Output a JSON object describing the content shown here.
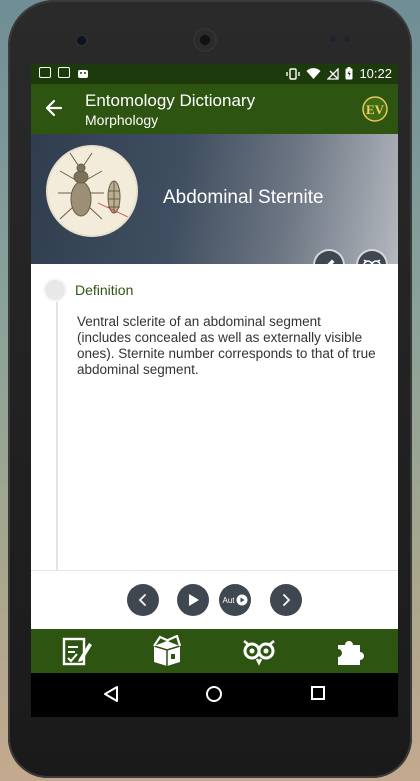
{
  "status_bar": {
    "time": "10:22",
    "left_icons": [
      "image-icon",
      "clipboard-check-icon",
      "android-icon"
    ],
    "right_icons": [
      "vibrate-icon",
      "wifi-icon",
      "signal-icon",
      "battery-icon"
    ]
  },
  "app_bar": {
    "title": "Entomology Dictionary",
    "subtitle": "Morphology",
    "back_icon": "arrow-left-icon",
    "logo_text": "EV"
  },
  "entry": {
    "term": "Abdominal Sternite",
    "section_label": "Definition",
    "definition": "Ventral sclerite of an abdominal segment (includes concealed as well as externally visible ones). Sternite number corresponds to that of true abdominal segment."
  },
  "player": {
    "prev_icon": "chevron-left-icon",
    "play_icon": "play-icon",
    "auto_label": "Aut",
    "next_icon": "chevron-right-icon"
  },
  "bottom_nav": [
    "quiz-icon",
    "box-icon",
    "owl-icon",
    "puzzle-icon"
  ],
  "colors": {
    "primary": "#2e5412",
    "primary_dark": "#1d3a0c",
    "button_bg": "#3f4750",
    "accent_text": "#2e5412"
  }
}
